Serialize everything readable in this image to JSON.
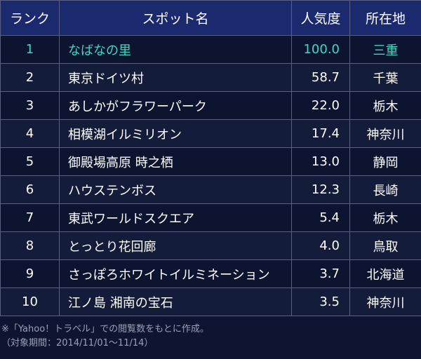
{
  "headers": {
    "rank": "ランク",
    "spot": "スポット名",
    "popularity": "人気度",
    "prefecture": "所在地"
  },
  "rows": [
    {
      "rank": "1",
      "spot": "なばなの里",
      "popularity": "100.0",
      "prefecture": "三重"
    },
    {
      "rank": "2",
      "spot": "東京ドイツ村",
      "popularity": "58.7",
      "prefecture": "千葉"
    },
    {
      "rank": "3",
      "spot": "あしかがフラワーパーク",
      "popularity": "22.0",
      "prefecture": "栃木"
    },
    {
      "rank": "4",
      "spot": "相模湖イルミリオン",
      "popularity": "17.4",
      "prefecture": "神奈川"
    },
    {
      "rank": "5",
      "spot": "御殿場高原 時之栖",
      "popularity": "13.0",
      "prefecture": "静岡"
    },
    {
      "rank": "6",
      "spot": "ハウステンボス",
      "popularity": "12.3",
      "prefecture": "長崎"
    },
    {
      "rank": "7",
      "spot": "東武ワールドスクエア",
      "popularity": "5.4",
      "prefecture": "栃木"
    },
    {
      "rank": "8",
      "spot": "とっとり花回廊",
      "popularity": "4.0",
      "prefecture": "鳥取"
    },
    {
      "rank": "9",
      "spot": "さっぽろホワイトイルミネーション",
      "popularity": "3.7",
      "prefecture": "北海道"
    },
    {
      "rank": "10",
      "spot": "江ノ島 湘南の宝石",
      "popularity": "3.5",
      "prefecture": "神奈川"
    }
  ],
  "footnote": {
    "line1": "※「Yahoo！トラベル」での閲覧数をもとに作成。",
    "line2": "（対象期間：2014/11/01〜11/14）"
  },
  "colors": {
    "header_bg": "#1b2a6e",
    "highlight_text": "#3fd9c0",
    "background": "#0d1530"
  }
}
